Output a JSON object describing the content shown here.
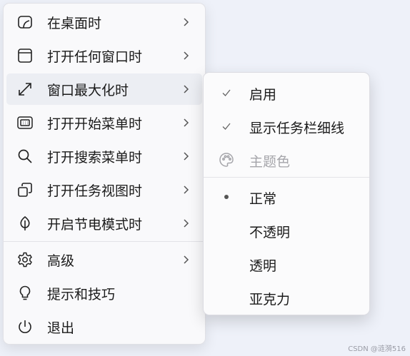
{
  "menu": {
    "items": [
      {
        "label": "在桌面时",
        "icon": "desktop-icon"
      },
      {
        "label": "打开任何窗口时",
        "icon": "window-icon"
      },
      {
        "label": "窗口最大化时",
        "icon": "maximize-icon"
      },
      {
        "label": "打开开始菜单时",
        "icon": "start-menu-icon"
      },
      {
        "label": "打开搜索菜单时",
        "icon": "search-icon"
      },
      {
        "label": "打开任务视图时",
        "icon": "task-view-icon"
      },
      {
        "label": "开启节电模式时",
        "icon": "leaf-icon"
      },
      {
        "label": "高级",
        "icon": "gear-icon"
      },
      {
        "label": "提示和技巧",
        "icon": "lightbulb-icon"
      },
      {
        "label": "退出",
        "icon": "power-icon"
      }
    ]
  },
  "submenu": {
    "items": [
      {
        "label": "启用",
        "mark": "check"
      },
      {
        "label": "显示任务栏细线",
        "mark": "check"
      },
      {
        "label": "主题色",
        "mark": "palette-icon",
        "disabled": true
      },
      {
        "label": "正常",
        "mark": "dot"
      },
      {
        "label": "不透明",
        "mark": ""
      },
      {
        "label": "透明",
        "mark": ""
      },
      {
        "label": "亚克力",
        "mark": ""
      }
    ]
  },
  "watermark": "CSDN @涟漪516",
  "colors": {
    "background": "#eef1f9",
    "menu": "#f9f9fb",
    "active": "#eceef3",
    "disabled_text": "#a5a5aa"
  }
}
